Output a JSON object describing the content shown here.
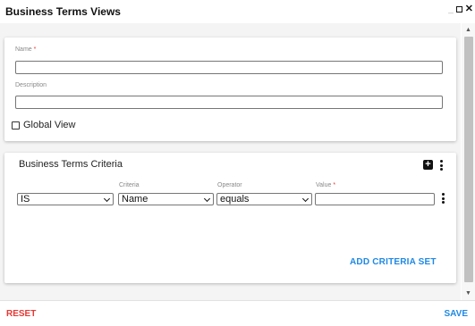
{
  "window": {
    "title": "Business Terms Views"
  },
  "form": {
    "name_label": "Name",
    "name_required_marker": "*",
    "name_value": "",
    "description_label": "Description",
    "description_value": "",
    "global_view_label": "Global View",
    "global_view_checked": false
  },
  "criteria": {
    "title": "Business Terms Criteria",
    "row": {
      "condition_value": "IS",
      "criteria_label": "Criteria",
      "criteria_value": "Name",
      "operator_label": "Operator",
      "operator_value": "equals",
      "value_label": "Value",
      "value_required_marker": "*",
      "value_value": ""
    },
    "add_criteria_set_label": "ADD CRITERIA SET"
  },
  "footer": {
    "reset_label": "RESET",
    "save_label": "SAVE"
  },
  "colors": {
    "accent": "#1e88e5",
    "danger": "#e53935",
    "background": "#f4f4f4"
  },
  "icons": [
    "minimize-icon",
    "maximize-icon",
    "close-icon",
    "plus-box-icon",
    "more-vert-icon",
    "chevron-down-icon",
    "scroll-up-icon",
    "scroll-down-icon"
  ]
}
